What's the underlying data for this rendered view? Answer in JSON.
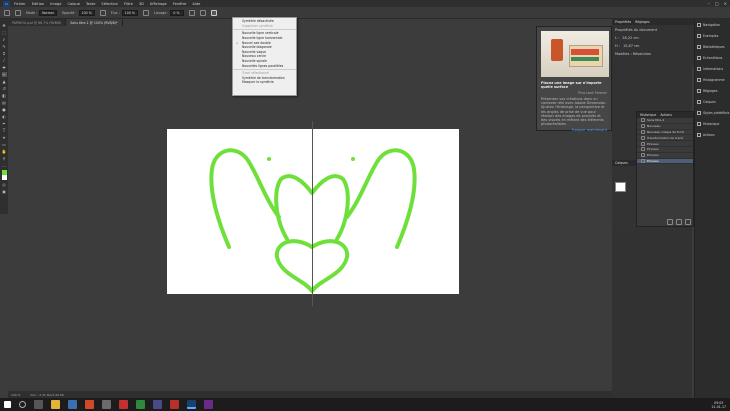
{
  "app": {
    "logo": "Ps"
  },
  "menu": [
    "Fichier",
    "Edition",
    "Image",
    "Calque",
    "Texte",
    "Sélection",
    "Filtre",
    "3D",
    "Affichage",
    "Fenêtre",
    "Aide"
  ],
  "window_controls": [
    "–",
    "□",
    "×"
  ],
  "options": {
    "mode_label": "Mode :",
    "mode_value": "Normal",
    "opacity_label": "Opacité :",
    "opacity_value": "100 %",
    "flux_label": "Flux :",
    "flux_value": "100 %",
    "smooth_label": "Lissage :",
    "smooth_value": "0 %"
  },
  "tabs": [
    "PAPAYOU.psd @ 66,7% (RVB/8)",
    "Sans titre-1 @ 100% (RVB/8)*"
  ],
  "dropdown": {
    "items": [
      {
        "label": "Symétrie désactivée",
        "disabled": false,
        "check": ""
      },
      {
        "label": "Supprimer symétrie",
        "disabled": true,
        "check": ""
      },
      {
        "label": "",
        "sep": true
      },
      {
        "label": "Nouvelle ligne verticale",
        "disabled": false,
        "check": ""
      },
      {
        "label": "Nouvelle ligne horizontale",
        "disabled": false,
        "check": ""
      },
      {
        "label": "Nouvel axe double",
        "disabled": false,
        "check": "✓"
      },
      {
        "label": "Nouvelle diagonale",
        "disabled": false,
        "check": ""
      },
      {
        "label": "Nouvelle vague",
        "disabled": false,
        "check": ""
      },
      {
        "label": "Nouveau cercle",
        "disabled": false,
        "check": ""
      },
      {
        "label": "Nouvelle spirale",
        "disabled": false,
        "check": ""
      },
      {
        "label": "Nouvelles lignes parallèles",
        "disabled": false,
        "check": ""
      },
      {
        "label": "",
        "sep": true
      },
      {
        "label": "Tracé sélectionné",
        "disabled": true,
        "check": ""
      },
      {
        "label": "Symétrie de transformation",
        "disabled": false,
        "check": ""
      },
      {
        "label": "Masquer la symétrie",
        "disabled": false,
        "check": ""
      }
    ]
  },
  "properties": {
    "tabs": [
      "Propriétés",
      "Réglages"
    ],
    "title": "Propriétés du document",
    "w_label": "L :",
    "w_value": "28,22 cm",
    "h_label": "H :",
    "h_value": "15,87 cm",
    "modes": "Modèles : Résolution"
  },
  "popup": {
    "headline": "Placez une image sur n'importe quelle surface",
    "meta": "Plus tard   Fermer",
    "body": "Présentez vos créations dans un contexte réel avec Adobe Dimension. Ajustez l'éclairage, la perspective et les angles de prise de vue pour réaliser des images de produits et des visuels en mêlant des éléments photoréalistes.",
    "link": "Essayer maintenant"
  },
  "rightbar": [
    "Navigation",
    "Exemples",
    "Bibliothèques",
    "Échantillons",
    "Informations",
    "Histogramme",
    "Réglages",
    "Calques",
    "Styles prédéfinis",
    "Historique",
    "Actions"
  ],
  "history": {
    "tabs": [
      "Historique",
      "Actions"
    ],
    "rows": [
      {
        "label": "Sans titre-1",
        "sel": false
      },
      {
        "label": "Nouveau",
        "sel": false
      },
      {
        "label": "Nouveau calque de fond",
        "sel": false
      },
      {
        "label": "Transformation du tracé",
        "sel": false
      },
      {
        "label": "Pinceau",
        "sel": false
      },
      {
        "label": "Pinceau",
        "sel": false
      },
      {
        "label": "Pinceau",
        "sel": false
      },
      {
        "label": "Pinceau",
        "sel": true
      }
    ]
  },
  "layers_label": "Calques",
  "status": {
    "zoom": "100 %",
    "doc": "Doc : 2,31 Mo/3,49 Mo"
  },
  "clock": {
    "time": "09:05",
    "date": "21-01-17"
  }
}
